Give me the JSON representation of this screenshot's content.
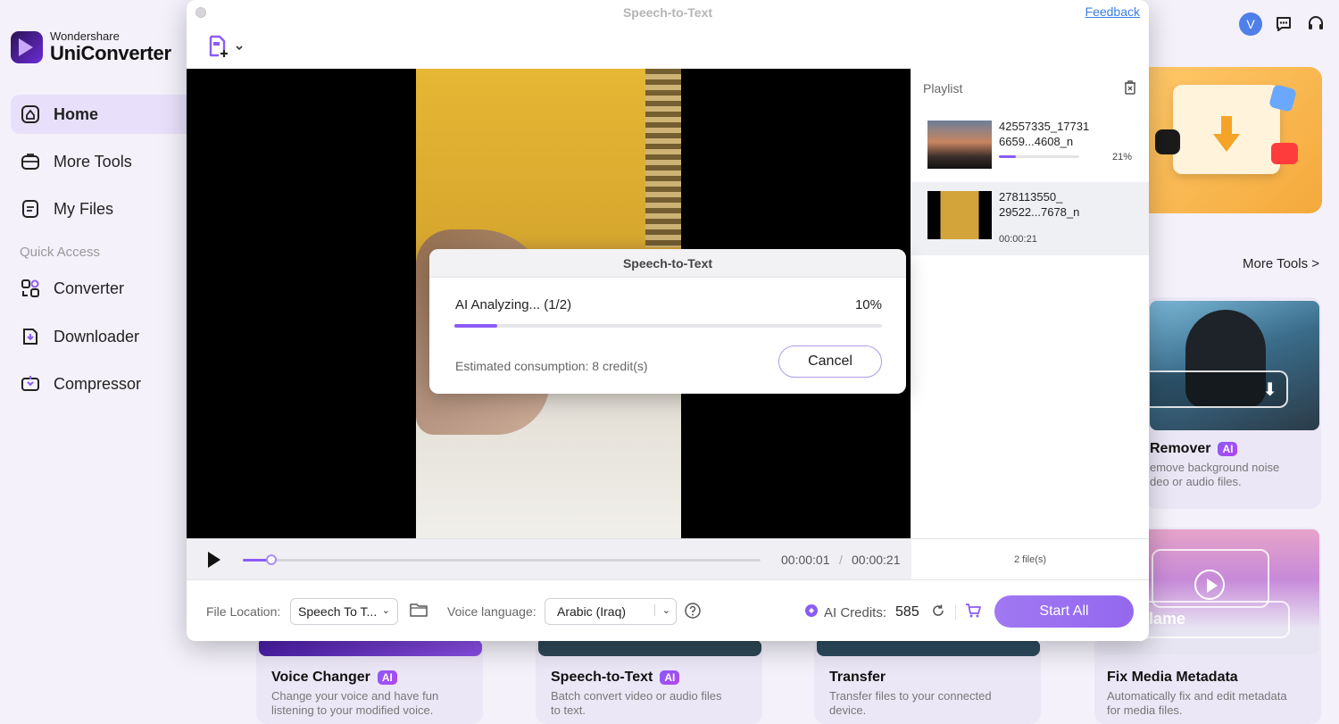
{
  "app": {
    "brand_small": "Wondershare",
    "brand_big": "UniConverter",
    "accent_color": "#8b5cf6"
  },
  "sidebar": {
    "items": [
      {
        "label": "Home",
        "icon": "home-icon"
      },
      {
        "label": "More Tools",
        "icon": "toolbox-icon"
      },
      {
        "label": "My Files",
        "icon": "file-icon"
      }
    ],
    "section_label": "Quick Access",
    "quick_access": [
      {
        "label": "Converter",
        "icon": "converter-icon"
      },
      {
        "label": "Downloader",
        "icon": "downloader-icon"
      },
      {
        "label": "Compressor",
        "icon": "compressor-icon"
      }
    ]
  },
  "header": {
    "avatar_letter": "V"
  },
  "main": {
    "more_tools_link": "More Tools >",
    "noise_card": {
      "title": "Remover",
      "desc1": "emove background noise",
      "desc2": "deo or audio files."
    },
    "meta_card": {
      "title": "Fix Media Metadata",
      "desc1": "Automatically fix and edit metadata",
      "desc2": "for media files.",
      "overlay_text": "lame"
    },
    "bottom_cards": [
      {
        "title": "Voice Changer",
        "ai": true,
        "desc1": "Change your voice and have fun",
        "desc2": "listening to your modified voice."
      },
      {
        "title": "Speech-to-Text",
        "ai": true,
        "desc1": "Batch convert video or audio files",
        "desc2": "to text."
      },
      {
        "title": "Transfer",
        "ai": false,
        "desc1": "Transfer files to your connected",
        "desc2": "device."
      }
    ],
    "ai_badge": "AI"
  },
  "dialog": {
    "title": "Speech-to-Text",
    "feedback": "Feedback",
    "playlist": {
      "header": "Playlist",
      "items": [
        {
          "name1": "42557335_17731",
          "name2": "6659...4608_n",
          "progress": 0.21,
          "percent_label": "21%"
        },
        {
          "name1": "278113550_",
          "name2": "29522...7678_n",
          "duration": "00:00:21"
        }
      ],
      "file_count": "2 file(s)"
    },
    "player": {
      "current_time": "00:00:01",
      "separator": "/",
      "total_time": "00:00:21",
      "seek_progress": 0.05
    },
    "bottom": {
      "file_location_label": "File Location:",
      "file_location_value": "Speech To T...",
      "voice_language_label": "Voice language:",
      "voice_language_value": "Arabic (Iraq)",
      "credits_label": "AI Credits:",
      "credits_value": "585",
      "start_all": "Start All"
    }
  },
  "modal": {
    "title": "Speech-to-Text",
    "status": "AI Analyzing... (1/2)",
    "percent_label": "10%",
    "progress": 0.1,
    "estimate": "Estimated consumption: 8 credit(s)",
    "cancel": "Cancel"
  }
}
